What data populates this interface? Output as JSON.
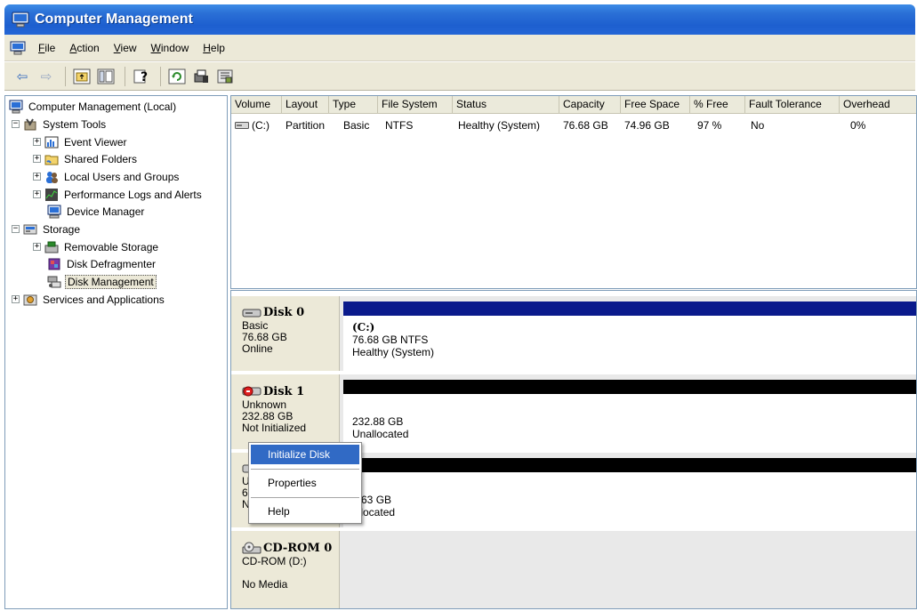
{
  "window": {
    "title": "Computer Management"
  },
  "menubar": {
    "items": [
      {
        "label": "File",
        "mnemonic": "F",
        "rest": "ile"
      },
      {
        "label": "Action",
        "mnemonic": "A",
        "rest": "ction"
      },
      {
        "label": "View",
        "mnemonic": "V",
        "rest": "iew"
      },
      {
        "label": "Window",
        "mnemonic": "W",
        "rest": "indow"
      },
      {
        "label": "Help",
        "mnemonic": "H",
        "rest": "elp"
      }
    ]
  },
  "toolbar": {
    "buttons": [
      "back-icon",
      "forward-icon",
      "up-folder-icon",
      "show-hide-tree-icon",
      "help-icon",
      "refresh-icon",
      "properties-icon",
      "export-icon"
    ],
    "back": "⇦",
    "forward": "⇨"
  },
  "tree": {
    "items": [
      {
        "label": "Computer Management (Local)",
        "icon": "computer-icon"
      },
      {
        "label": "System Tools",
        "icon": "tools-icon",
        "expander": "−"
      },
      {
        "label": "Event Viewer",
        "icon": "event-viewer-icon",
        "expander": "+"
      },
      {
        "label": "Shared Folders",
        "icon": "shared-folder-icon",
        "expander": "+"
      },
      {
        "label": "Local Users and Groups",
        "icon": "users-icon",
        "expander": "+"
      },
      {
        "label": "Performance Logs and Alerts",
        "icon": "performance-icon",
        "expander": "+"
      },
      {
        "label": "Device Manager",
        "icon": "device-manager-icon"
      },
      {
        "label": "Storage",
        "icon": "storage-icon",
        "expander": "−"
      },
      {
        "label": "Removable Storage",
        "icon": "removable-storage-icon",
        "expander": "+"
      },
      {
        "label": "Disk Defragmenter",
        "icon": "defragmenter-icon"
      },
      {
        "label": "Disk Management",
        "icon": "disk-management-icon",
        "selected": true
      },
      {
        "label": "Services and Applications",
        "icon": "services-icon",
        "expander": "+"
      }
    ]
  },
  "volumes": {
    "columns": [
      "Volume",
      "Layout",
      "Type",
      "File System",
      "Status",
      "Capacity",
      "Free Space",
      "% Free",
      "Fault Tolerance",
      "Overhead"
    ],
    "rows": [
      [
        "(C:)",
        "Partition",
        "Basic",
        "NTFS",
        "Healthy (System)",
        "76.68 GB",
        "74.96 GB",
        "97 %",
        "No",
        "0%"
      ]
    ]
  },
  "disks": [
    {
      "name": "Disk 0",
      "lines": [
        "Basic",
        "76.68 GB",
        "Online"
      ],
      "bar_color": "#0a1a8c",
      "partition": {
        "title": "(C:)",
        "lines": [
          "76.68 GB NTFS",
          "Healthy (System)"
        ]
      }
    },
    {
      "name": "Disk 1",
      "lines": [
        "Unknown",
        "232.88 GB",
        "Not Initialized"
      ],
      "bar_color": "#000000",
      "partition": {
        "title": "",
        "lines": [
          "232.88 GB",
          "Unallocated"
        ]
      }
    },
    {
      "name": "",
      "lines": [
        "U",
        "6",
        "N"
      ],
      "bar_color": "#000000",
      "partition": {
        "title": "",
        "lines": [
          "8.63 GB",
          "allocated"
        ]
      }
    },
    {
      "name": "CD-ROM 0",
      "lines": [
        "CD-ROM (D:)",
        "",
        "No Media"
      ],
      "bar_color": "",
      "partition": {
        "title": "",
        "lines": []
      }
    }
  ],
  "context_menu": {
    "items": [
      "Initialize Disk",
      "Properties",
      "Help"
    ],
    "highlight_color": "#316ac5"
  },
  "colors": {
    "title_bar": "#2466d6",
    "chrome": "#ece9d8",
    "primary_partition_bar": "#0a1a8c",
    "unallocated_bar": "#000000"
  }
}
